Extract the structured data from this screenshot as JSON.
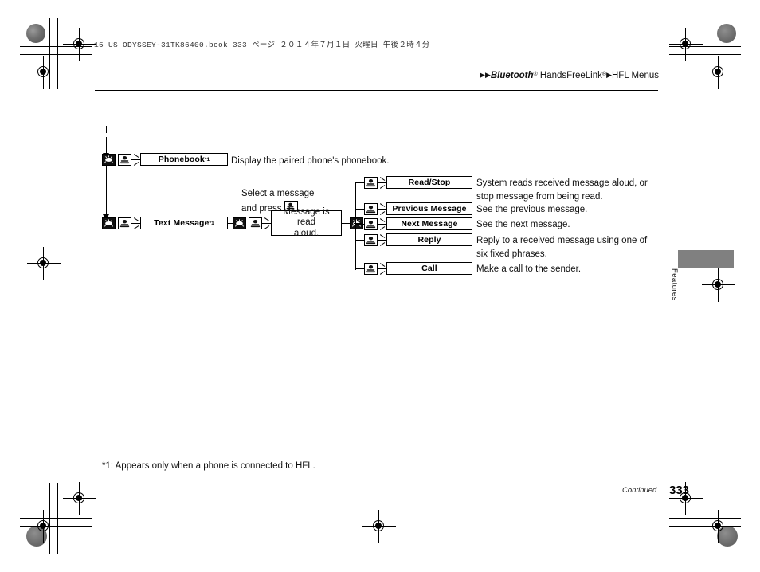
{
  "header": {
    "book_line": "15 US ODYSSEY-31TK86400.book   333 ページ   ２０１４年７月１日   火曜日   午後２時４分",
    "breadcrumb": {
      "arrow1": "▶▶",
      "brand": "Bluetooth",
      "brand_sup": "®",
      "product": " HandsFreeLink",
      "product_sup": "®",
      "arrow2": "▶",
      "section": "HFL Menus"
    }
  },
  "side_tab": {
    "label": "Features",
    "color": "#808080"
  },
  "diagram": {
    "icons": {
      "talk_button": "talk-button-icon",
      "pickup_button": "pickup-button-icon"
    },
    "rows": [
      {
        "label": "Phonebook",
        "footnote_marker": "*1",
        "description": "Display the paired phone's phonebook."
      },
      {
        "label": "Text Message",
        "footnote_marker": "*1",
        "description": ""
      }
    ],
    "callout": {
      "line1": "Select a message",
      "line2_prefix": "and press ",
      "line2_suffix": "."
    },
    "note_box": {
      "line1": "Message is read",
      "line2": "aloud."
    },
    "submenu": [
      {
        "label": "Read/Stop",
        "description_line1": "System reads received message aloud, or",
        "description_line2": "stop message from being read."
      },
      {
        "label": "Previous Message",
        "description_line1": "See the previous message.",
        "description_line2": ""
      },
      {
        "label": "Next Message",
        "description_line1": "See the next message.",
        "description_line2": ""
      },
      {
        "label": "Reply",
        "description_line1": "Reply to a received message using one of",
        "description_line2": "six fixed phrases."
      },
      {
        "label": "Call",
        "description_line1": "Make a call to the sender.",
        "description_line2": ""
      }
    ]
  },
  "footnote": "*1: Appears only when a phone is connected to HFL.",
  "footer": {
    "continued": "Continued",
    "page_number": "333"
  }
}
